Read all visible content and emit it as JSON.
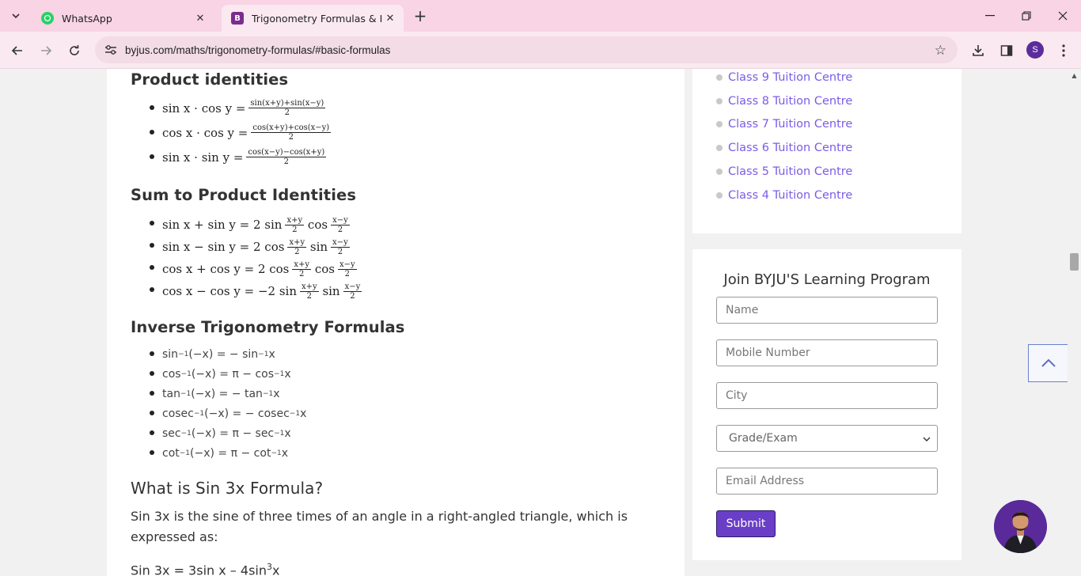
{
  "browser": {
    "tabs": [
      {
        "title": "WhatsApp",
        "active": false
      },
      {
        "title": "Trigonometry Formulas & Ident",
        "active": true
      }
    ],
    "url": "byjus.com/maths/trigonometry-formulas/#basic-formulas",
    "profile_initial": "S"
  },
  "article": {
    "product_heading": "Product identities",
    "product_items": [
      {
        "lhs": "sin x · cos y =",
        "num": "sin(x+y)+sin(x−y)",
        "den": "2"
      },
      {
        "lhs": "cos x · cos y =",
        "num": "cos(x+y)+cos(x−y)",
        "den": "2"
      },
      {
        "lhs": "sin x · sin y =",
        "num": "cos(x−y)−cos(x+y)",
        "den": "2"
      }
    ],
    "sum_heading": "Sum to Product Identities",
    "sum_items": [
      {
        "lhs": "sin x + sin y = 2 sin",
        "f1": "cos",
        "f2": "",
        "n1": "x+y",
        "n2": "x−y"
      },
      {
        "lhs": "sin x − sin y = 2 cos",
        "f1": "sin",
        "n1": "x+y",
        "n2": "x−y"
      },
      {
        "lhs": "cos x + cos y = 2 cos",
        "f1": "cos",
        "n1": "x+y",
        "n2": "x−y"
      },
      {
        "lhs": "cos x − cos y = −2 sin",
        "f1": "sin",
        "n1": "x+y",
        "n2": "x−y"
      }
    ],
    "inverse_heading": "Inverse Trigonometry Formulas",
    "inverse_items": [
      {
        "a": "sin",
        "mid": " (−x) = − sin",
        "end": " x"
      },
      {
        "a": "cos",
        "mid": " (−x) = π − cos",
        "end": " x"
      },
      {
        "a": "tan",
        "mid": " (−x) = − tan",
        "end": " x"
      },
      {
        "a": "cosec",
        "mid": " (−x) = − cosec",
        "end": " x"
      },
      {
        "a": "sec",
        "mid": " (−x) = π − sec",
        "end": " x"
      },
      {
        "a": "cot",
        "mid": " (−x) = π − cot",
        "end": " x"
      }
    ],
    "sup": "−1",
    "sin3x_heading": "What is Sin 3x Formula?",
    "sin3x_para": "Sin 3x is the sine of three times of an angle in a right-angled triangle, which is expressed as:",
    "sin3x_formula_a": "Sin 3x = 3sin x – 4sin",
    "sin3x_formula_sup": "3",
    "sin3x_formula_b": "x"
  },
  "sidebar": {
    "tuition_links": [
      "Class 9 Tuition Centre",
      "Class 8 Tuition Centre",
      "Class 7 Tuition Centre",
      "Class 6 Tuition Centre",
      "Class 5 Tuition Centre",
      "Class 4 Tuition Centre"
    ],
    "form": {
      "title": "Join BYJU'S Learning Program",
      "name_placeholder": "Name",
      "mobile_placeholder": "Mobile Number",
      "city_placeholder": "City",
      "grade_selected": "Grade/Exam",
      "email_placeholder": "Email Address",
      "submit_label": "Submit"
    }
  },
  "colors": {
    "accent": "#6a3ec7",
    "link": "#7b5ce6",
    "tabbar": "#f8d4e4"
  }
}
